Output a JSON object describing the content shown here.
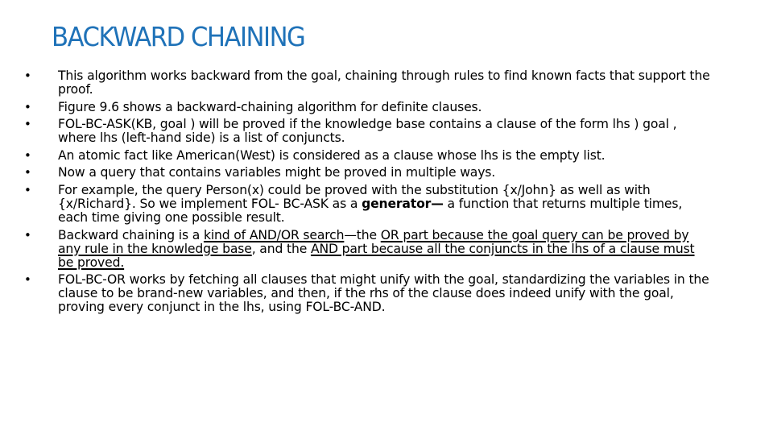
{
  "slide": {
    "title": "BACKWARD CHAINING",
    "title_color": "#1f72b8",
    "bullet_symbol": "•",
    "bullets": [
      {
        "segments": [
          {
            "text": "This algorithm works backward from the goal, chaining through rules to find known facts that support the proof."
          }
        ]
      },
      {
        "segments": [
          {
            "text": "Figure 9.6 shows a backward-chaining algorithm for definite clauses."
          }
        ]
      },
      {
        "segments": [
          {
            "text": "FOL-BC-ASK(KB, goal ) will be proved if the knowledge base contains a clause of the form lhs ) goal , where lhs (left-hand side) is a list of conjuncts."
          }
        ]
      },
      {
        "segments": [
          {
            "text": "An atomic fact like American(West) is considered as a clause whose lhs is the empty list."
          }
        ]
      },
      {
        "segments": [
          {
            "text": "Now a query that contains variables might be proved in multiple ways."
          }
        ]
      },
      {
        "segments": [
          {
            "text": "For example, the query Person(x) could be proved with the substitution {x/John} as well as with {x/Richard}. So we implement FOL- BC-ASK as a "
          },
          {
            "text": "generator—",
            "style": "bold"
          },
          {
            "text": " a function that returns multiple times, each time giving one possible result."
          }
        ]
      },
      {
        "segments": [
          {
            "text": "Backward chaining is a "
          },
          {
            "text": "kind of AND/OR search",
            "style": "underline"
          },
          {
            "text": "—the "
          },
          {
            "text": "OR part because the goal query can be proved by any rule in the knowledge base",
            "style": "underline"
          },
          {
            "text": ", and the "
          },
          {
            "text": "AND part because all the conjuncts in the lhs of a clause must be proved.",
            "style": "underline"
          }
        ]
      },
      {
        "segments": [
          {
            "text": "FOL-BC-OR works by fetching all clauses that might unify with the goal, standardizing the variables in the clause to be brand-new variables, and then, if the rhs of the clause does indeed unify with the goal, proving every conjunct in the lhs, using FOL-BC-AND."
          }
        ]
      }
    ]
  }
}
